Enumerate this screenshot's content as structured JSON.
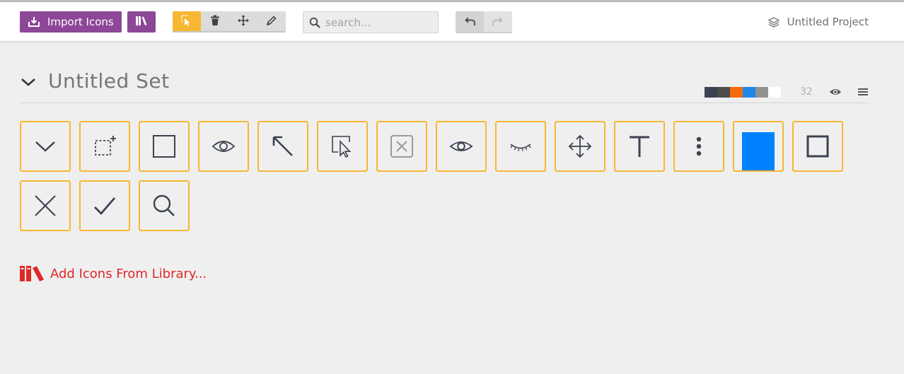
{
  "toolbar": {
    "import_label": "Import Icons",
    "search_placeholder": "search...",
    "project_name": "Untitled Project"
  },
  "set": {
    "title": "Untitled Set",
    "count": "32",
    "swatches": [
      "#3b4250",
      "#4d4d4d",
      "#f36c0c",
      "#1f87e6",
      "#929292",
      "#ffffff"
    ]
  },
  "icons": [
    "chevron-down",
    "selection-add",
    "square",
    "eye-outline",
    "arrow-up-left",
    "cursor-select",
    "close-box",
    "eye",
    "eye-closed",
    "move",
    "text",
    "dots-vertical",
    "blue-rectangle",
    "square-thick",
    "close",
    "check",
    "magnify"
  ],
  "footer": {
    "add_label": "Add Icons From Library..."
  },
  "colors": {
    "purple": "#8c4796",
    "accent": "#f7b733",
    "red": "#e02828",
    "blue": "#0081ff"
  }
}
